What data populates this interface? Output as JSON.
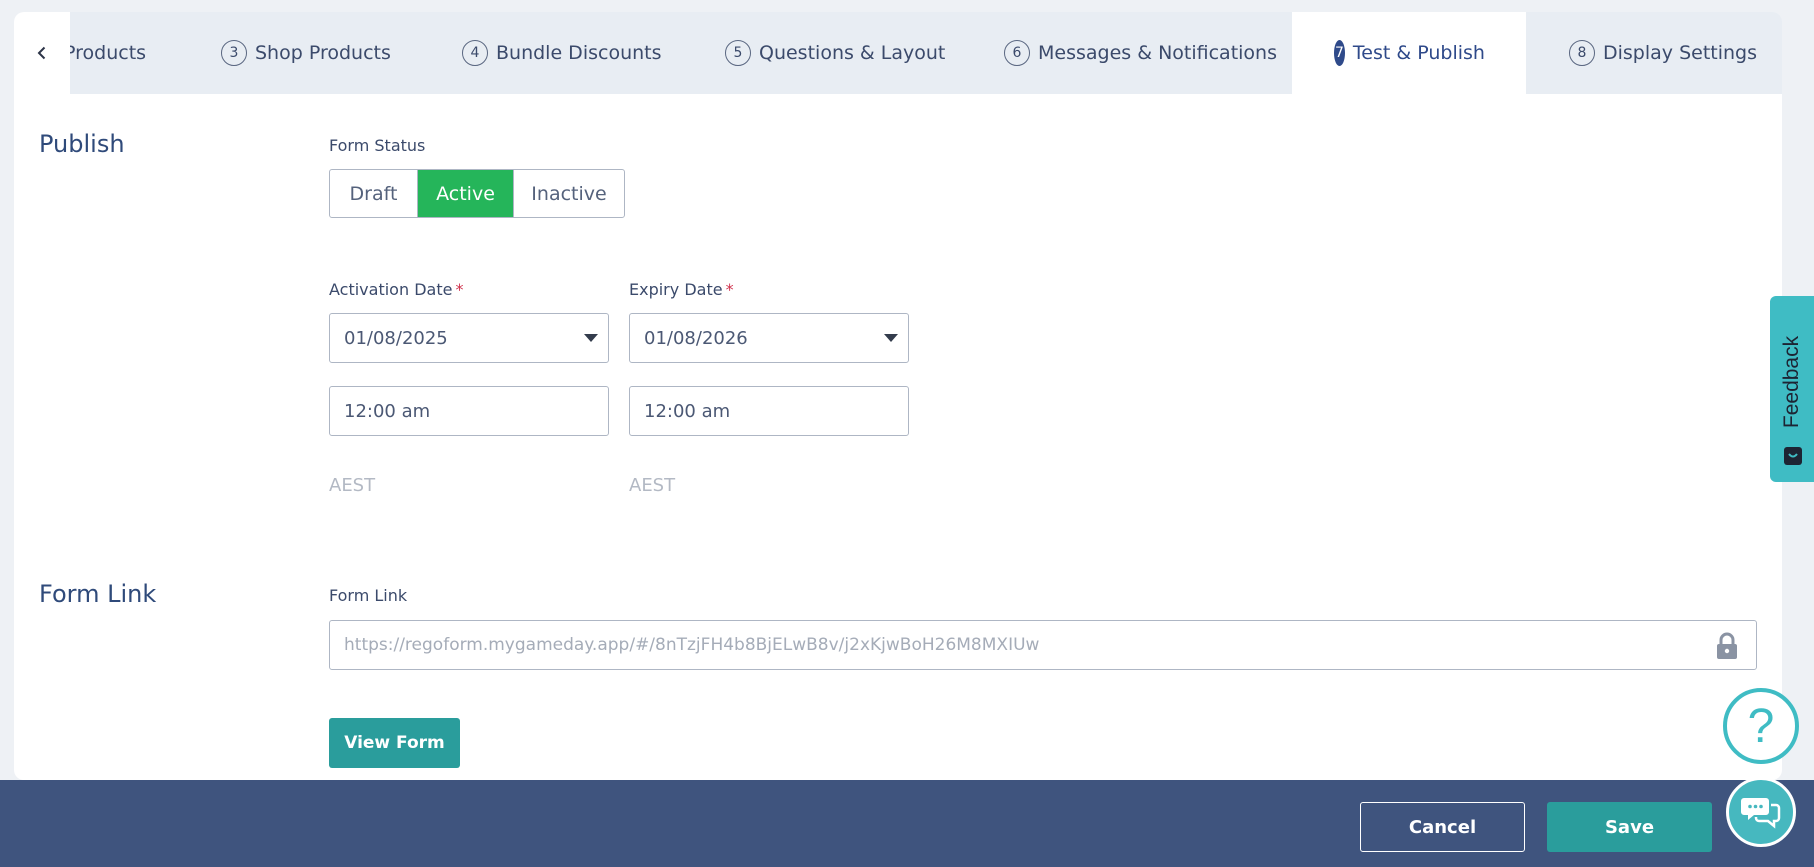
{
  "tabs": [
    {
      "label": "Products"
    },
    {
      "num": "3",
      "label": "Shop Products"
    },
    {
      "num": "4",
      "label": "Bundle Discounts"
    },
    {
      "num": "5",
      "label": "Questions & Layout"
    },
    {
      "num": "6",
      "label": "Messages & Notifications"
    },
    {
      "num": "7",
      "label": "Test & Publish",
      "active": true
    },
    {
      "num": "8",
      "label": "Display Settings"
    }
  ],
  "publish": {
    "title": "Publish",
    "status_label": "Form Status",
    "status_options": [
      "Draft",
      "Active",
      "Inactive"
    ],
    "status_selected": "Active",
    "activation": {
      "label": "Activation Date",
      "required": "*",
      "date": "01/08/2025",
      "time": "12:00 am",
      "tz": "AEST"
    },
    "expiry": {
      "label": "Expiry Date",
      "required": "*",
      "date": "01/08/2026",
      "time": "12:00 am",
      "tz": "AEST"
    }
  },
  "form_link": {
    "title": "Form Link",
    "label": "Form Link",
    "url": "https://regoform.mygameday.app/#/8nTzjFH4b8BjELwB8v/j2xKjwBoH26M8MXIUw",
    "view_button": "View Form"
  },
  "footer": {
    "cancel": "Cancel",
    "save": "Save"
  },
  "widgets": {
    "feedback": "Feedback",
    "help": "?"
  },
  "colors": {
    "accent_green": "#25b55a",
    "teal": "#2a9d9c",
    "footer_bg": "#3f547e",
    "active_tab": "#2f4a8a"
  },
  "icons": [
    "chevron-left-icon",
    "chevron-down-icon",
    "lock-icon",
    "feedback-icon",
    "help-icon",
    "chat-icon"
  ]
}
